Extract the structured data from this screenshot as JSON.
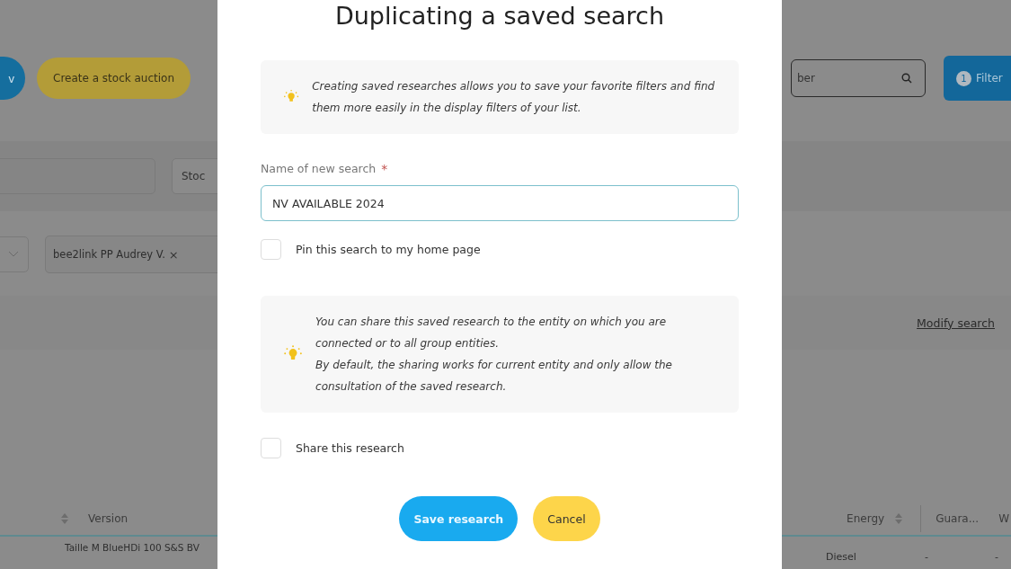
{
  "background": {
    "toolbar": {
      "round_button": "v",
      "auction_button": "Create a stock auction",
      "search_field": {
        "value": "ber"
      },
      "filter_button": {
        "badge": "1",
        "label": "Filter"
      }
    },
    "filters": {
      "stock_chip": "Stoc",
      "tag": {
        "label": "bee2link PP Audrey V.",
        "remove": "×"
      }
    },
    "modify_link": "Modify search",
    "table": {
      "left_columns": [
        {
          "sortable": true
        },
        {
          "label": "Version",
          "sortable": false
        }
      ],
      "right_columns": [
        {
          "label": "Energy",
          "sortable": true
        },
        {
          "label": "Guara...",
          "sortable": false
        },
        {
          "label": "W",
          "sortable": false
        }
      ],
      "rows": [
        {
          "version": "Taille M BlueHDi 100 S&S BV",
          "energy": "Diesel",
          "guarantee": "-",
          "column_4": "-"
        }
      ]
    }
  },
  "dialog": {
    "title": "Duplicating a saved search",
    "info": [
      "Creating saved researches allows you to save your favorite filters and find them more easily in the display filters of your list."
    ],
    "name_field": {
      "label": "Name of new search",
      "required_mark": "*",
      "value": "NV AVAILABLE 2024"
    },
    "pin_checkbox": {
      "label": "Pin this search to my home page",
      "checked": false
    },
    "share_info": [
      "You can share this saved research to the entity on which you are connected or to all group entities.",
      "By default, the sharing works for current entity and only allow the consultation of the saved research."
    ],
    "share_checkbox": {
      "label": "Share this research",
      "checked": false
    },
    "buttons": [
      {
        "label": "Save research",
        "kind": "primary"
      },
      {
        "label": "Cancel",
        "kind": "secondary"
      }
    ]
  }
}
